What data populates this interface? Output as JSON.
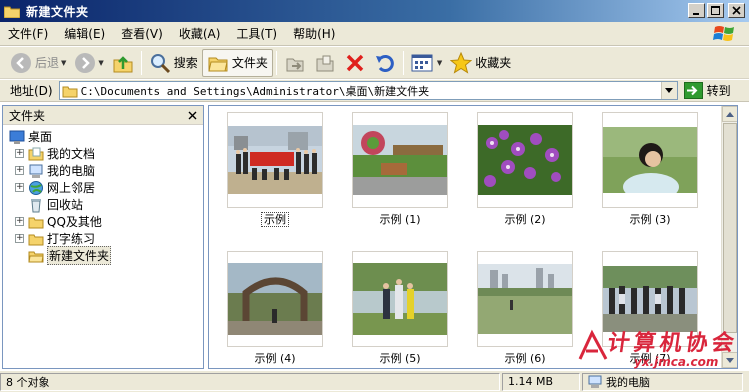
{
  "window": {
    "title": "新建文件夹",
    "icon": "folder-icon",
    "buttons": [
      "minimize-icon",
      "maximize-icon",
      "close-icon"
    ]
  },
  "menu": {
    "items": [
      {
        "label": "文件(F)"
      },
      {
        "label": "编辑(E)"
      },
      {
        "label": "查看(V)"
      },
      {
        "label": "收藏(A)"
      },
      {
        "label": "工具(T)"
      },
      {
        "label": "帮助(H)"
      }
    ]
  },
  "toolbar": {
    "back_label": "后退",
    "search_label": "搜索",
    "folders_label": "文件夹",
    "favorites_label": "收藏夹"
  },
  "address": {
    "label": "地址(D)",
    "value": "C:\\Documents and Settings\\Administrator\\桌面\\新建文件夹",
    "go_label": "转到"
  },
  "folders_pane": {
    "title": "文件夹",
    "root": "桌面",
    "items": [
      {
        "label": "我的文档",
        "expandable": true
      },
      {
        "label": "我的电脑",
        "expandable": true
      },
      {
        "label": "网上邻居",
        "expandable": true
      },
      {
        "label": "回收站",
        "expandable": false
      },
      {
        "label": "QQ及其他",
        "expandable": true
      },
      {
        "label": "打字练习",
        "expandable": true
      },
      {
        "label": "新建文件夹",
        "expandable": false,
        "selected": true
      }
    ]
  },
  "files": [
    {
      "name": "示例",
      "selected": true
    },
    {
      "name": "示例 (1)"
    },
    {
      "name": "示例 (2)"
    },
    {
      "name": "示例 (3)"
    },
    {
      "name": "示例 (4)"
    },
    {
      "name": "示例 (5)"
    },
    {
      "name": "示例 (6)"
    },
    {
      "name": "示例 (7)"
    }
  ],
  "status": {
    "count": "8 个对象",
    "size": "1.14 MB",
    "location": "我的电脑"
  },
  "watermark": {
    "text": "计算机协会",
    "url": "yx.jmca.com"
  },
  "colors": {
    "titlebar": "#0a246a",
    "chrome": "#ece9d8",
    "pane_border": "#7a96bf",
    "watermark": "#d9263c"
  }
}
